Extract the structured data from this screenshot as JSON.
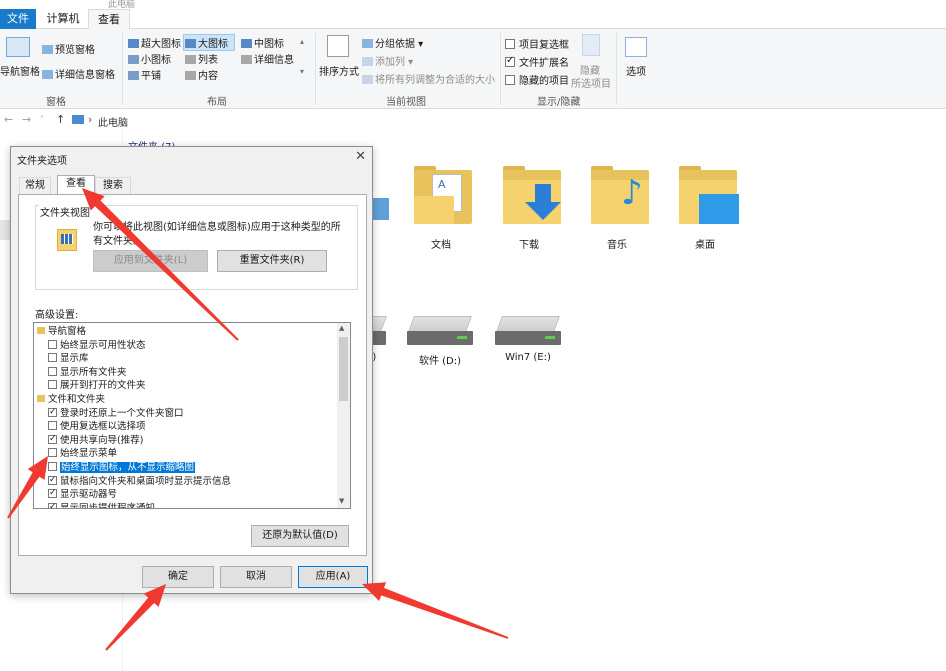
{
  "window": {
    "title_crumb": "此电脑"
  },
  "ribbon": {
    "tabs": [
      "文件",
      "计算机",
      "查看"
    ],
    "pane_group": {
      "nav_pane": "导航窗格",
      "preview_pane": "预览窗格",
      "details_pane": "详细信息窗格",
      "label": "窗格"
    },
    "layout_group": {
      "items": [
        "超大图标",
        "大图标",
        "中图标",
        "小图标",
        "列表",
        "详细信息",
        "平铺",
        "内容"
      ],
      "selected": "大图标",
      "label": "布局"
    },
    "current_view_group": {
      "sort_by": "排序方式",
      "group_by": "分组依据",
      "add_column": "添加列",
      "fit_columns": "将所有列调整为合适的大小",
      "label": "当前视图"
    },
    "show_hide_group": {
      "item_checkboxes": "项目复选框",
      "file_extensions": "文件扩展名",
      "hidden_items": "隐藏的项目",
      "hide_selected_line1": "隐藏",
      "hide_selected_line2": "所选项目",
      "label": "显示/隐藏",
      "item_checkboxes_checked": false,
      "file_extensions_checked": true,
      "hidden_items_checked": false
    },
    "options": "选项"
  },
  "address": {
    "path": "此电脑"
  },
  "content": {
    "section_peek": "文件夹 (7)",
    "folders": [
      {
        "label": "文档"
      },
      {
        "label": "下载"
      },
      {
        "label": "音乐"
      },
      {
        "label": "桌面"
      }
    ],
    "drives": [
      {
        "label": ":)"
      },
      {
        "label": "软件 (D:)"
      },
      {
        "label": "Win7 (E:)"
      }
    ]
  },
  "dialog": {
    "title": "文件夹选项",
    "tabs": [
      "常规",
      "查看",
      "搜索"
    ],
    "active_tab": "查看",
    "folder_views": {
      "legend": "文件夹视图",
      "desc_line1": "你可以将此视图(如详细信息或图标)应用于这种类型的所",
      "desc_line2": "有文件夹。",
      "apply_btn": "应用到文件夹(L)",
      "reset_btn": "重置文件夹(R)"
    },
    "advanced": {
      "label": "高级设置:",
      "items": [
        {
          "text": "导航窗格",
          "type": "folder"
        },
        {
          "text": "始终显示可用性状态",
          "type": "check",
          "checked": false
        },
        {
          "text": "显示库",
          "type": "check",
          "checked": false
        },
        {
          "text": "显示所有文件夹",
          "type": "check",
          "checked": false
        },
        {
          "text": "展开到打开的文件夹",
          "type": "check",
          "checked": false
        },
        {
          "text": "文件和文件夹",
          "type": "folder"
        },
        {
          "text": "登录时还原上一个文件夹窗口",
          "type": "check",
          "checked": true
        },
        {
          "text": "使用复选框以选择项",
          "type": "check",
          "checked": false
        },
        {
          "text": "使用共享向导(推荐)",
          "type": "check",
          "checked": true
        },
        {
          "text": "始终显示菜单",
          "type": "check",
          "checked": false
        },
        {
          "text": "始终显示图标，从不显示缩略图",
          "type": "check",
          "checked": false,
          "highlight": true
        },
        {
          "text": "鼠标指向文件夹和桌面项时显示提示信息",
          "type": "check",
          "checked": true
        },
        {
          "text": "显示驱动器号",
          "type": "check",
          "checked": true
        },
        {
          "text": "显示同步提供程序通知",
          "type": "check",
          "checked": true
        }
      ],
      "restore_btn": "还原为默认值(D)"
    },
    "ok_btn": "确定",
    "cancel_btn": "取消",
    "apply_btn": "应用(A)"
  },
  "colors": {
    "accent": "#1979ca",
    "annotation_arrow": "#f03a2f",
    "folder": "#f5d26e"
  }
}
